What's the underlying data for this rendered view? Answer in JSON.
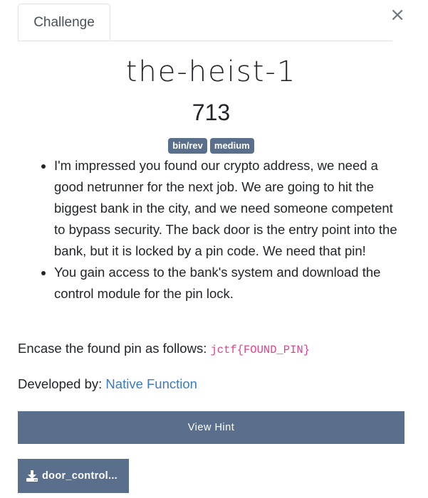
{
  "tabs": [
    {
      "label": "Challenge"
    }
  ],
  "close_label": "×",
  "challenge": {
    "name": "the-heist-1",
    "points": "713",
    "tags": [
      "bin/rev",
      "medium"
    ],
    "description": [
      "I'm impressed you found our crypto address, we need a good netrunner for the next job. We are going to hit the biggest bank in the city, and we need someone competent to bypass security. The back door is the entry point into the bank, but it is locked by a pin code. We need that pin!",
      "You gain access to the bank's system and download the control module for the pin lock."
    ],
    "encase_text": "Encase the found pin as follows: ",
    "flag_format": "jctf{FOUND_PIN}",
    "developed_by_label": "Developed by: ",
    "developer": "Native Function"
  },
  "buttons": {
    "view_hint": "View Hint",
    "file": "door_control..."
  },
  "colors": {
    "accent": "#5a6f8c",
    "link": "#3b7bbf",
    "code": "#e83e8c"
  },
  "icons": {
    "close": "close-icon",
    "download": "download-icon"
  }
}
